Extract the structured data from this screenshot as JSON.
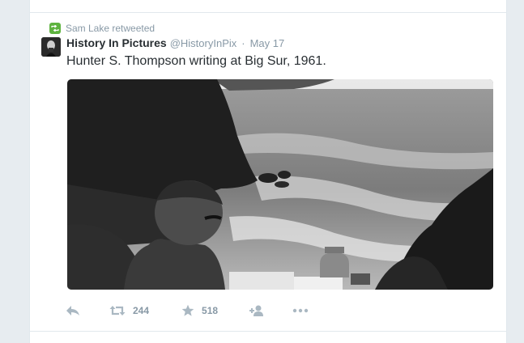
{
  "retweet_context": {
    "icon": "retweet-icon",
    "text": "Sam Lake retweeted",
    "badge_color": "#5eb33f"
  },
  "tweet": {
    "avatar": "lincoln-portrait-avatar",
    "fullname": "History In Pictures",
    "username": "@HistoryInPix",
    "separator": "·",
    "timestamp": "May 17",
    "text": "Hunter S. Thompson writing at Big Sur, 1961.",
    "media": {
      "kind": "photo",
      "palette": "black-and-white"
    }
  },
  "actions": {
    "reply": {
      "icon": "reply-icon"
    },
    "retweet": {
      "icon": "retweet-icon",
      "count": "244"
    },
    "favorite": {
      "icon": "star-icon",
      "count": "518"
    },
    "follow": {
      "icon": "follow-user-icon"
    },
    "more": {
      "icon": "more-dots-icon"
    }
  },
  "colors": {
    "name_text": "#292f33",
    "meta_text": "#8899a6",
    "action_icon": "#aab8c2",
    "divider": "#e1e8ed",
    "page_background": "#e7ecf0"
  }
}
